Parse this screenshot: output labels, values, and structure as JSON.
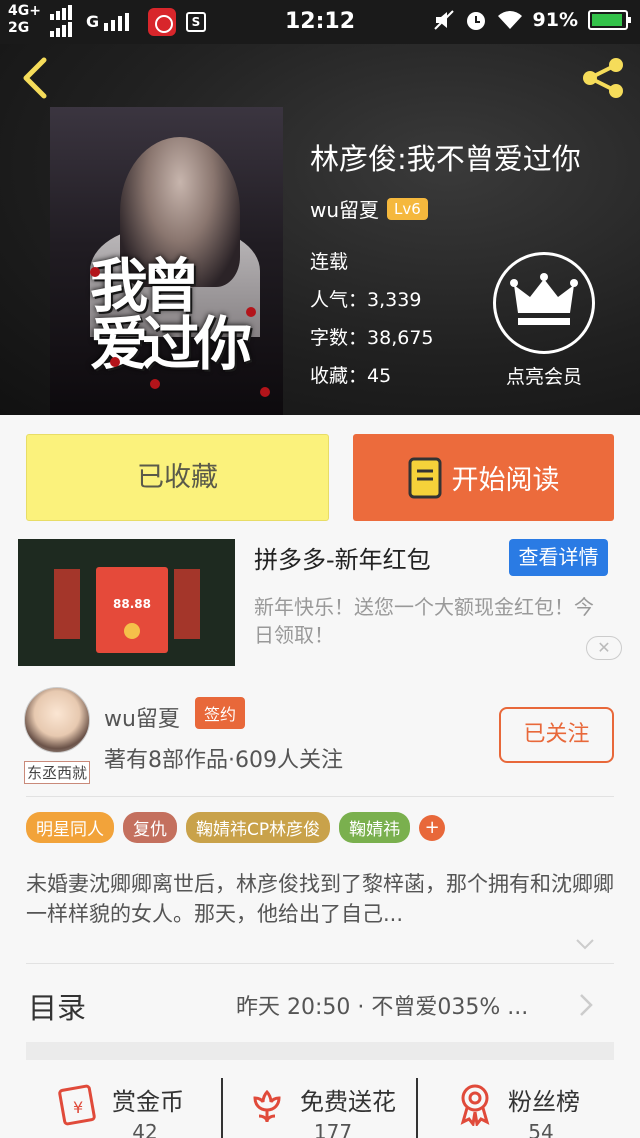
{
  "status_bar": {
    "network_top": "4G+",
    "network_bottom": "2G",
    "network_g": "G",
    "app_badge": "S",
    "time": "12:12",
    "battery": "91%"
  },
  "book": {
    "title": "林彦俊:我不曾爱过你",
    "author": "wu留夏",
    "level": "Lv6",
    "status": "连载",
    "popularity_label": "人气：",
    "popularity": "3,339",
    "words_label": "字数：",
    "words": "38,675",
    "favorites_label": "收藏：",
    "favorites": "45",
    "vip_label": "点亮会员"
  },
  "actions": {
    "favorited": "已收藏",
    "start_reading": "开始阅读"
  },
  "ad": {
    "title": "拼多多-新年红包",
    "detail_button": "查看详情",
    "description": "新年快乐！送您一个大额现金红包！今日领取！",
    "amount": "88.88",
    "close": "✕"
  },
  "author_section": {
    "name": "wu留夏",
    "badge": "签约",
    "description": "著有8部作品·609人关注",
    "follow_button": "已关注",
    "avatar_tag": "东丞西就"
  },
  "tags": [
    {
      "label": "明星同人",
      "color": "#f2a33a"
    },
    {
      "label": "复仇",
      "color": "#c4705e"
    },
    {
      "label": "鞠婧祎CP林彦俊",
      "color": "#c9a24a"
    },
    {
      "label": "鞠婧祎",
      "color": "#7ab04e"
    }
  ],
  "summary": "未婚妻沈卿卿离世后，林彦俊找到了黎梓菡，那个拥有和沈卿卿一样样貌的女人。那天，他给出了自己...",
  "toc": {
    "label": "目录",
    "latest": "昨天 20:50 · 不曾爱035% ..."
  },
  "bottom": [
    {
      "label": "赏金币",
      "count": "42"
    },
    {
      "label": "免费送花",
      "count": "177"
    },
    {
      "label": "粉丝榜",
      "count": "54"
    }
  ],
  "colors": {
    "accent_orange": "#e8683a",
    "favorite_yellow": "#fbf27c",
    "read_orange": "#ec6b3c",
    "ad_blue": "#2a7be4",
    "level_gold": "#f5b83d"
  }
}
